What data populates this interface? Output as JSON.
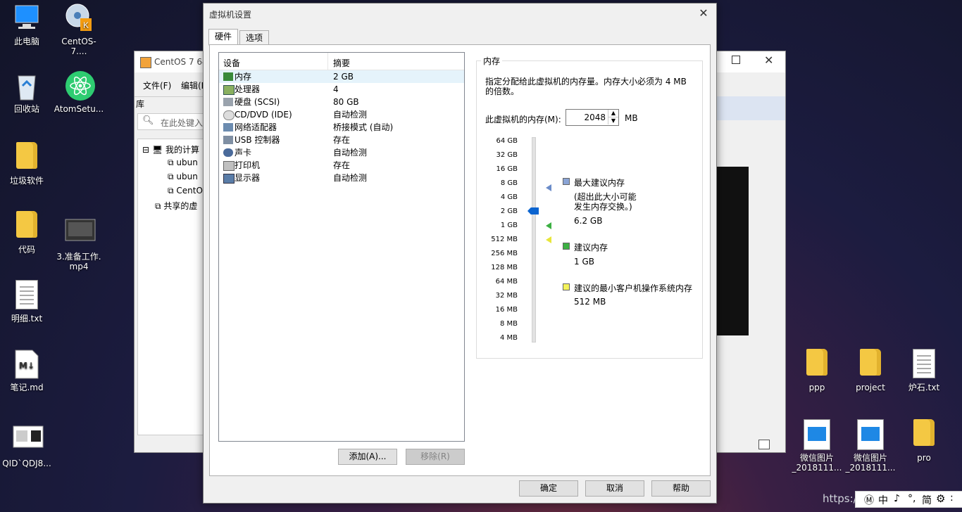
{
  "desktop": {
    "icons_left": [
      {
        "label": "此电脑",
        "icon": "computer-icon"
      },
      {
        "label": "CentOS-7....",
        "icon": "app-icon"
      },
      {
        "label": "回收站",
        "icon": "recycle-bin-icon"
      },
      {
        "label": "AtomSetu...",
        "icon": "atom-icon"
      },
      {
        "label": "垃圾软件",
        "icon": "folder-icon"
      },
      {
        "label": "代码",
        "icon": "folder-icon"
      },
      {
        "label": "3.准备工作.",
        "label2": "mp4",
        "icon": "video-icon"
      },
      {
        "label": "明细.txt",
        "icon": "text-file-icon"
      },
      {
        "label": "笔记.md",
        "icon": "markdown-file-icon"
      },
      {
        "label": "QID`QDJ8...",
        "icon": "image-file-icon"
      }
    ],
    "icons_right": [
      {
        "label": "ppp",
        "icon": "folder-icon"
      },
      {
        "label": "project",
        "icon": "folder-icon"
      },
      {
        "label": "炉石.txt",
        "icon": "text-file-icon"
      },
      {
        "label": "微信图片",
        "label2": "_2018111...",
        "icon": "image-file-icon"
      },
      {
        "label": "微信图片",
        "label2": "_2018111...",
        "icon": "image-file-icon"
      },
      {
        "label": "pro",
        "icon": "folder-icon"
      }
    ]
  },
  "background_window": {
    "title": "CentOS 7 64",
    "menu": [
      "文件(F)",
      "编辑(E"
    ],
    "library_label": "库",
    "search_placeholder": "在此处键入",
    "tree": [
      "我的计算",
      "ubun",
      "ubun",
      "CentO",
      "共享的虚"
    ]
  },
  "dialog": {
    "title": "虚拟机设置",
    "tabs": [
      "硬件",
      "选项"
    ],
    "device_list": {
      "col_device": "设备",
      "col_summary": "摘要",
      "rows": [
        {
          "name": "内存",
          "summary": "2 GB",
          "icon": "memory-icon"
        },
        {
          "name": "处理器",
          "summary": "4",
          "icon": "processor-icon"
        },
        {
          "name": "硬盘 (SCSI)",
          "summary": "80 GB",
          "icon": "hard-disk-icon"
        },
        {
          "name": "CD/DVD (IDE)",
          "summary": "自动检测",
          "icon": "cd-dvd-icon"
        },
        {
          "name": "网络适配器",
          "summary": "桥接模式 (自动)",
          "icon": "network-adapter-icon"
        },
        {
          "name": "USB 控制器",
          "summary": "存在",
          "icon": "usb-icon"
        },
        {
          "name": "声卡",
          "summary": "自动检测",
          "icon": "sound-card-icon"
        },
        {
          "name": "打印机",
          "summary": "存在",
          "icon": "printer-icon"
        },
        {
          "name": "显示器",
          "summary": "自动检测",
          "icon": "monitor-icon"
        }
      ]
    },
    "add_button": "添加(A)...",
    "remove_button": "移除(R)",
    "memory": {
      "group_title": "内存",
      "description": "指定分配给此虚拟机的内存量。内存大小必须为 4 MB 的倍数。",
      "description_line1": "指定分配给此虚拟机的内存量。内存大小必须为 4 MB",
      "description_line2": "的倍数。",
      "field_label": "此虚拟机的内存(M):",
      "value": "2048",
      "unit": "MB",
      "scale": [
        "64 GB",
        "32 GB",
        "16 GB",
        "8 GB",
        "4 GB",
        "2 GB",
        "1 GB",
        "512 MB",
        "256 MB",
        "128 MB",
        "64 MB",
        "32 MB",
        "16 MB",
        "8 MB",
        "4 MB"
      ],
      "slider_value": "2 GB",
      "max_recommended_title": "最大建议内存",
      "max_recommended_note1": "(超出此大小可能",
      "max_recommended_note2": "发生内存交换。)",
      "max_recommended_value": "6.2 GB",
      "recommended_title": "建议内存",
      "recommended_value": "1 GB",
      "min_recommended_title": "建议的最小客户机操作系统内存",
      "min_recommended_value": "512 MB",
      "colors": {
        "max": "#6b8cc9",
        "recommended": "#3cb043",
        "min": "#f3f25a"
      }
    },
    "ok_button": "确定",
    "cancel_button": "取消",
    "help_button": "帮助"
  },
  "taskbar": {
    "ime": "中",
    "ime_mode": "简",
    "watermark": "https://"
  }
}
